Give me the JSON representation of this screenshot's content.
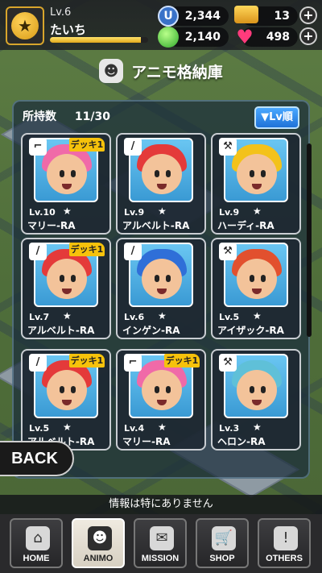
{
  "player": {
    "level": "Lv.6",
    "name": "たいち",
    "xp_progress": 0.93
  },
  "currencies": [
    {
      "name": "ucoin",
      "icon": "U",
      "value": "2,344"
    },
    {
      "name": "gold",
      "icon": "gold-bar-icon",
      "value": "13"
    },
    {
      "name": "gem",
      "icon": "green-orb-icon",
      "value": "2,140"
    },
    {
      "name": "heart",
      "icon": "heart-icon",
      "value": "498"
    }
  ],
  "storage": {
    "title": "アニモ格納庫",
    "count_label": "所持数",
    "count_value": "11/30",
    "sort_label": "▼Lv順"
  },
  "cards": [
    {
      "lv": "Lv.10",
      "name": "マリー-RA",
      "deck": "デッキ1",
      "weapon": "gun",
      "hair": "#f06aa8"
    },
    {
      "lv": "Lv.9",
      "name": "アルベルト-RA",
      "deck": "",
      "weapon": "sword",
      "hair": "#e43a3a"
    },
    {
      "lv": "Lv.9",
      "name": "ハーディ-RA",
      "deck": "",
      "weapon": "hammer",
      "hair": "#f3c21a"
    },
    {
      "lv": "Lv.7",
      "name": "アルベルト-RA",
      "deck": "デッキ1",
      "weapon": "sword",
      "hair": "#e43a3a"
    },
    {
      "lv": "Lv.6",
      "name": "インゲン-RA",
      "deck": "",
      "weapon": "sword",
      "hair": "#2f6fd8"
    },
    {
      "lv": "Lv.5",
      "name": "アイザック-RA",
      "deck": "",
      "weapon": "hammer",
      "hair": "#e2502e"
    },
    {
      "lv": "Lv.5",
      "name": "アルベルト-RA",
      "deck": "デッキ1",
      "weapon": "sword",
      "hair": "#e43a3a"
    },
    {
      "lv": "Lv.4",
      "name": "マリー-RA",
      "deck": "デッキ1",
      "weapon": "gun",
      "hair": "#f06aa8"
    },
    {
      "lv": "Lv.3",
      "name": "ヘロン-RA",
      "deck": "",
      "weapon": "hammer",
      "hair": "#5fc0d8"
    }
  ],
  "back_label": "BACK",
  "info_text": "情報は特にありません",
  "nav": [
    {
      "label": "HOME",
      "icon": "home-icon",
      "glyph": "⌂"
    },
    {
      "label": "ANIMO",
      "icon": "animo-icon",
      "glyph": "☻"
    },
    {
      "label": "MISSION",
      "icon": "mission-icon",
      "glyph": "✉"
    },
    {
      "label": "SHOP",
      "icon": "cart-icon",
      "glyph": "🛒"
    },
    {
      "label": "OTHERS",
      "icon": "others-icon",
      "glyph": "!"
    }
  ]
}
